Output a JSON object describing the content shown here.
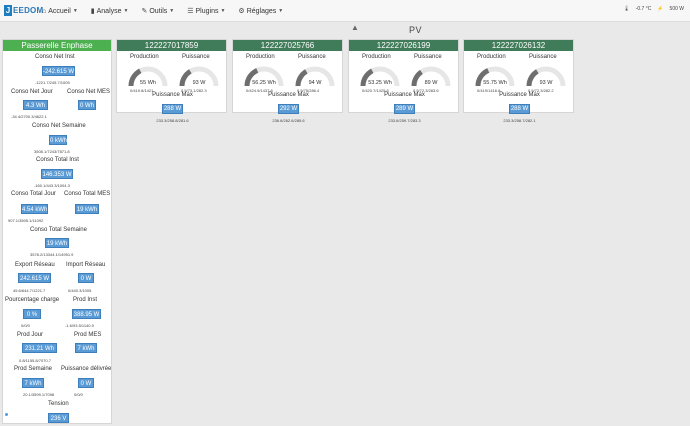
{
  "nav": {
    "logo_letter": "J",
    "logo_text": "EEDOM",
    "items": [
      {
        "label": "Accueil"
      },
      {
        "label": "Analyse"
      },
      {
        "label": "Outils"
      },
      {
        "label": "Plugins"
      },
      {
        "label": "Réglages"
      }
    ],
    "temperature": "-0.7 °C",
    "power": "500 W"
  },
  "section": {
    "title": "PV"
  },
  "passerelle": {
    "title": "Passerelle Enphase",
    "conso_net_inst": {
      "label": "Conso Net Inst",
      "value": "-242.615 W",
      "stats": "-1221.7/245.7/1005"
    },
    "conso_net_jour": {
      "label": "Conso Net Jour",
      "value": "4.3 Wh",
      "stats": "-34.4/2700.3/4622.1"
    },
    "conso_net_mes": {
      "label": "Conso Net MES",
      "value": "0 Wh"
    },
    "conso_net_semaine": {
      "label": "Conso Net Semaine",
      "value": "0 kWh",
      "stats": "3508.1/7243/7871.8"
    },
    "conso_total_inst": {
      "label": "Conso Total Inst",
      "value": "146.353 W",
      "stats": "-160.1/443.3/1004.3"
    },
    "conso_total_jour": {
      "label": "Conso Total Jour",
      "value": "4.54 kWh",
      "stats": "907.1/3505.1/11092"
    },
    "conso_total_mes": {
      "label": "Conso Total MES",
      "value": "19 kWh"
    },
    "conso_total_semaine": {
      "label": "Conso Total Semaine",
      "value": "19 kWh",
      "stats": "3578.2/13344.1/14951.9"
    },
    "export_reseau": {
      "label": "Export Réseau",
      "value": "242.615 W",
      "stats": "45.6/644.7/1221.7"
    },
    "import_reseau": {
      "label": "Import Réseau",
      "value": "0 W",
      "stats": "0/440.3/1005"
    },
    "pourcentage_charge": {
      "label": "Pourcentage charge",
      "value": "0 %",
      "stats": "0/0/0"
    },
    "prod_inst": {
      "label": "Prod Inst",
      "value": "388.95 W",
      "stats": "-1.6/93.5/1140.9"
    },
    "prod_jour": {
      "label": "Prod Jour",
      "value": "231.21 Wh",
      "stats": "0.8/1155.8/7070.7"
    },
    "prod_mes": {
      "label": "Prod MES",
      "value": "7 kWh"
    },
    "prod_semaine": {
      "label": "Prod Semaine",
      "value": "7 kWh",
      "stats": "20.1/3599.1/7098"
    },
    "puissance_delivree": {
      "label": "Puissance délivrée",
      "value": "0 W",
      "stats": "0/0/0"
    },
    "tension": {
      "label": "Tension",
      "value": "236 V"
    }
  },
  "inverters": [
    {
      "id": "122227017859",
      "production_label": "Production",
      "puissance_label": "Puissance",
      "production_value": "55 Wh",
      "puissance_value": "93 W",
      "production_stats": "0/419.8/1421",
      "puissance_stats": "0.5/73.1/282.3",
      "pmax_label": "Puissance Max",
      "pmax_value": "288 W",
      "pmax_stats": "233.3/258.8/281.6",
      "prod_fill": 0.35,
      "puis_fill": 0.33
    },
    {
      "id": "122227025766",
      "production_label": "Production",
      "puissance_label": "Puissance",
      "production_value": "56.25 Wh",
      "puissance_value": "94 W",
      "production_stats": "0/424.9/1437.8",
      "puissance_stats": "0.5/75/286.4",
      "pmax_label": "Puissance Max",
      "pmax_value": "292 W",
      "pmax_stats": "236.6/262.6/285.6",
      "prod_fill": 0.37,
      "puis_fill": 0.33
    },
    {
      "id": "122227026199",
      "production_label": "Production",
      "puissance_label": "Puissance",
      "production_value": "53.25 Wh",
      "puissance_value": "89 W",
      "production_stats": "0/420.7/1425.5",
      "puissance_stats": "0.5/72.3/283.6",
      "pmax_label": "Puissance Max",
      "pmax_value": "289 W",
      "pmax_stats": "233.6/259.7/283.3",
      "prod_fill": 0.35,
      "puis_fill": 0.31
    },
    {
      "id": "122227026132",
      "production_label": "Production",
      "puissance_label": "Puissance",
      "production_value": "55.75 Wh",
      "puissance_value": "93 W",
      "production_stats": "0/419/1416.8",
      "puissance_stats": "0.5/72.3/282.2",
      "pmax_label": "Puissance Max",
      "pmax_value": "288 W",
      "pmax_stats": "233.3/258.7/282.1",
      "prod_fill": 0.37,
      "puis_fill": 0.33
    }
  ]
}
